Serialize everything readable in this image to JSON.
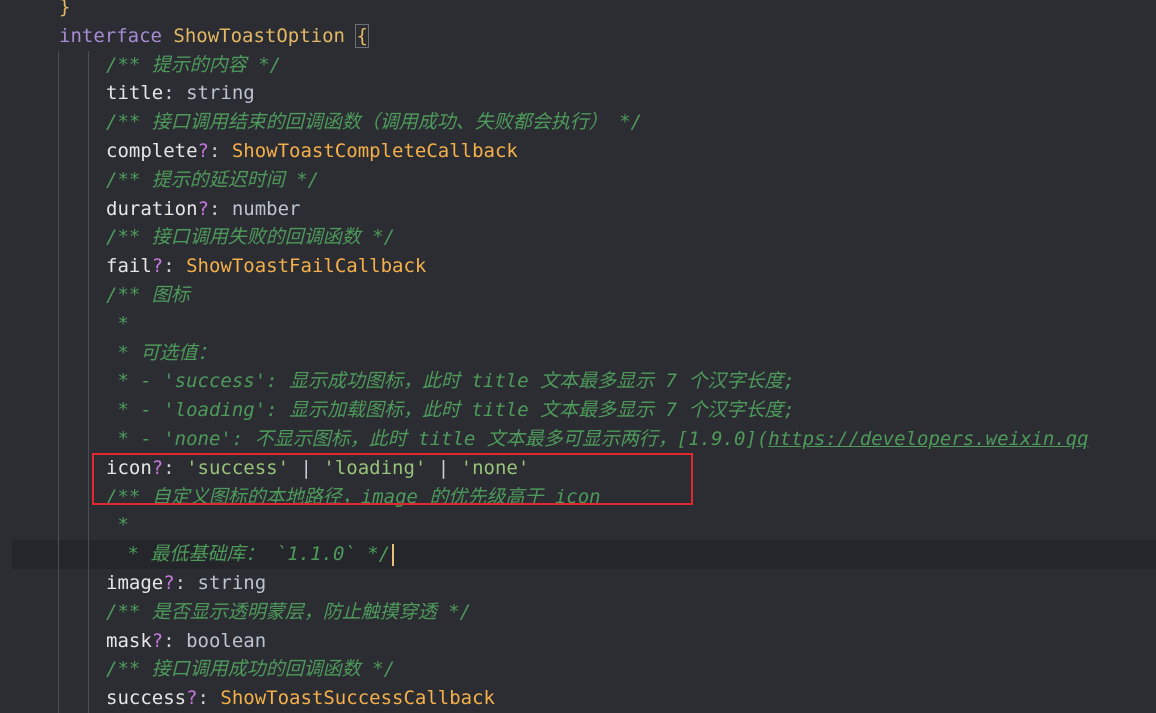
{
  "editor": {
    "theme_colors": {
      "background": "#2b2d33",
      "keyword": "#a78bd4",
      "type_reference": "#f5b049",
      "comment": "#4e9a5a",
      "string": "#98c379",
      "highlight_box": "#e0282e"
    },
    "lines": [
      {
        "indent": 1,
        "tokens": [
          {
            "text": "}",
            "kind": "brace"
          }
        ]
      },
      {
        "indent": 1,
        "tokens": [
          {
            "text": "interface",
            "kind": "kw"
          },
          {
            "text": " ",
            "kind": "punc"
          },
          {
            "text": "ShowToastOption",
            "kind": "type-name"
          },
          {
            "text": " ",
            "kind": "punc"
          },
          {
            "text": "{",
            "kind": "brace"
          }
        ]
      },
      {
        "indent": 2,
        "tokens": [
          {
            "text": "/** 提示的内容 */",
            "kind": "comment"
          }
        ]
      },
      {
        "indent": 2,
        "tokens": [
          {
            "text": "title",
            "kind": "prop"
          },
          {
            "text": ": ",
            "kind": "punc"
          },
          {
            "text": "string",
            "kind": "builtin"
          }
        ]
      },
      {
        "indent": 2,
        "tokens": [
          {
            "text": "/** 接口调用结束的回调函数（调用成功、失败都会执行） */",
            "kind": "comment"
          }
        ]
      },
      {
        "indent": 2,
        "tokens": [
          {
            "text": "complete",
            "kind": "prop"
          },
          {
            "text": "?",
            "kind": "op"
          },
          {
            "text": ": ",
            "kind": "punc"
          },
          {
            "text": "ShowToastCompleteCallback",
            "kind": "type"
          }
        ]
      },
      {
        "indent": 2,
        "tokens": [
          {
            "text": "/** 提示的延迟时间 */",
            "kind": "comment"
          }
        ]
      },
      {
        "indent": 2,
        "tokens": [
          {
            "text": "duration",
            "kind": "prop"
          },
          {
            "text": "?",
            "kind": "op"
          },
          {
            "text": ": ",
            "kind": "punc"
          },
          {
            "text": "number",
            "kind": "builtin"
          }
        ]
      },
      {
        "indent": 2,
        "tokens": [
          {
            "text": "/** 接口调用失败的回调函数 */",
            "kind": "comment"
          }
        ]
      },
      {
        "indent": 2,
        "tokens": [
          {
            "text": "fail",
            "kind": "prop"
          },
          {
            "text": "?",
            "kind": "op"
          },
          {
            "text": ": ",
            "kind": "punc"
          },
          {
            "text": "ShowToastFailCallback",
            "kind": "type"
          }
        ]
      },
      {
        "indent": 2,
        "tokens": [
          {
            "text": "/** 图标",
            "kind": "comment"
          }
        ]
      },
      {
        "indent": 2,
        "tokens": [
          {
            "text": " *",
            "kind": "comment"
          }
        ]
      },
      {
        "indent": 2,
        "tokens": [
          {
            "text": " * 可选值：",
            "kind": "comment"
          }
        ]
      },
      {
        "indent": 2,
        "tokens": [
          {
            "text": " * - 'success': 显示成功图标，此时 title 文本最多显示 7 个汉字长度;",
            "kind": "comment"
          }
        ]
      },
      {
        "indent": 2,
        "tokens": [
          {
            "text": " * - 'loading': 显示加载图标，此时 title 文本最多显示 7 个汉字长度;",
            "kind": "comment"
          }
        ]
      },
      {
        "indent": 2,
        "tokens": [
          {
            "text": " * - 'none': 不显示图标，此时 title 文本最多可显示两行，[1.9.0](",
            "kind": "comment"
          },
          {
            "text": "https://developers.weixin.qq",
            "kind": "link"
          }
        ]
      },
      {
        "indent": 2,
        "tokens": [
          {
            "text": "icon",
            "kind": "prop"
          },
          {
            "text": "?",
            "kind": "op"
          },
          {
            "text": ": ",
            "kind": "punc"
          },
          {
            "text": "'success'",
            "kind": "str"
          },
          {
            "text": " | ",
            "kind": "punc"
          },
          {
            "text": "'loading'",
            "kind": "str"
          },
          {
            "text": " | ",
            "kind": "punc"
          },
          {
            "text": "'none'",
            "kind": "str"
          }
        ]
      },
      {
        "indent": 2,
        "tokens": [
          {
            "text": "/** 自定义图标的本地路径，image 的优先级高于 icon",
            "kind": "comment"
          }
        ]
      },
      {
        "indent": 2,
        "tokens": [
          {
            "text": " *",
            "kind": "comment"
          }
        ]
      },
      {
        "indent": 2,
        "current": true,
        "tokens": [
          {
            "text": " * 最低基础库： `1.1.0` */",
            "kind": "comment"
          }
        ]
      },
      {
        "indent": 2,
        "tokens": [
          {
            "text": "image",
            "kind": "prop"
          },
          {
            "text": "?",
            "kind": "op"
          },
          {
            "text": ": ",
            "kind": "punc"
          },
          {
            "text": "string",
            "kind": "builtin"
          }
        ]
      },
      {
        "indent": 2,
        "tokens": [
          {
            "text": "/** 是否显示透明蒙层，防止触摸穿透 */",
            "kind": "comment"
          }
        ]
      },
      {
        "indent": 2,
        "tokens": [
          {
            "text": "mask",
            "kind": "prop"
          },
          {
            "text": "?",
            "kind": "op"
          },
          {
            "text": ": ",
            "kind": "punc"
          },
          {
            "text": "boolean",
            "kind": "builtin"
          }
        ]
      },
      {
        "indent": 2,
        "tokens": [
          {
            "text": "/** 接口调用成功的回调函数 */",
            "kind": "comment"
          }
        ]
      },
      {
        "indent": 2,
        "tokens": [
          {
            "text": "success",
            "kind": "prop"
          },
          {
            "text": "?",
            "kind": "op"
          },
          {
            "text": ": ",
            "kind": "punc"
          },
          {
            "text": "ShowToastSuccessCallback",
            "kind": "type"
          }
        ]
      }
    ]
  }
}
